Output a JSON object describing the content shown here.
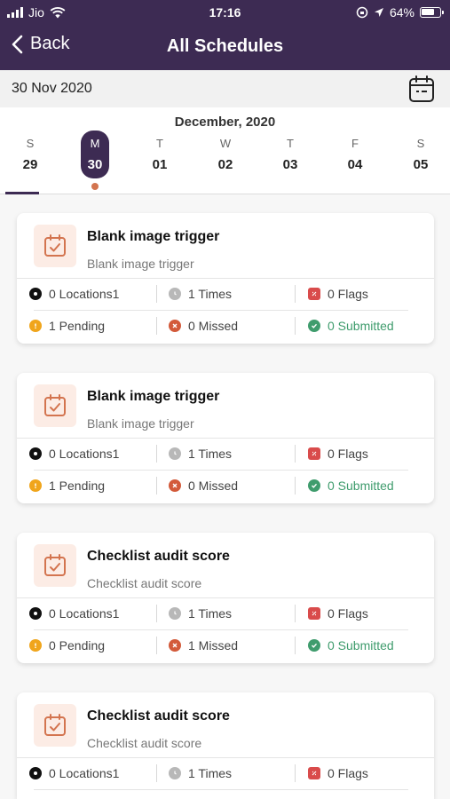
{
  "status_bar": {
    "carrier": "Jio",
    "time": "17:16",
    "battery": "64%"
  },
  "header": {
    "back_label": "Back",
    "title": "All Schedules"
  },
  "date_bar": {
    "selected_date": "30 Nov 2020"
  },
  "week": {
    "month_label": "December, 2020",
    "days": [
      {
        "name": "S",
        "num": "29"
      },
      {
        "name": "M",
        "num": "30"
      },
      {
        "name": "T",
        "num": "01"
      },
      {
        "name": "W",
        "num": "02"
      },
      {
        "name": "T",
        "num": "03"
      },
      {
        "name": "F",
        "num": "04"
      },
      {
        "name": "S",
        "num": "05"
      }
    ]
  },
  "colors": {
    "brand": "#3d2b53",
    "accent": "#d3744f",
    "pending": "#f0a51c",
    "missed": "#d35a3a",
    "submitted": "#3f9c6d",
    "flags": "#d94b4b",
    "times": "#b8b8b8"
  },
  "cards": [
    {
      "title": "Blank image trigger",
      "subtitle": "Blank image trigger",
      "locations": "0 Locations1",
      "times": "1 Times",
      "flags": "0 Flags",
      "pending": "1 Pending",
      "missed": "0 Missed",
      "submitted": "0 Submitted"
    },
    {
      "title": "Blank image trigger",
      "subtitle": "Blank image trigger",
      "locations": "0 Locations1",
      "times": "1 Times",
      "flags": "0 Flags",
      "pending": "1 Pending",
      "missed": "0 Missed",
      "submitted": "0 Submitted"
    },
    {
      "title": "Checklist audit score",
      "subtitle": "Checklist audit score",
      "locations": "0 Locations1",
      "times": "1 Times",
      "flags": "0 Flags",
      "pending": "0 Pending",
      "missed": "1 Missed",
      "submitted": "0 Submitted"
    },
    {
      "title": "Checklist audit score",
      "subtitle": "Checklist audit score",
      "locations": "0 Locations1",
      "times": "1 Times",
      "flags": "0 Flags"
    }
  ]
}
